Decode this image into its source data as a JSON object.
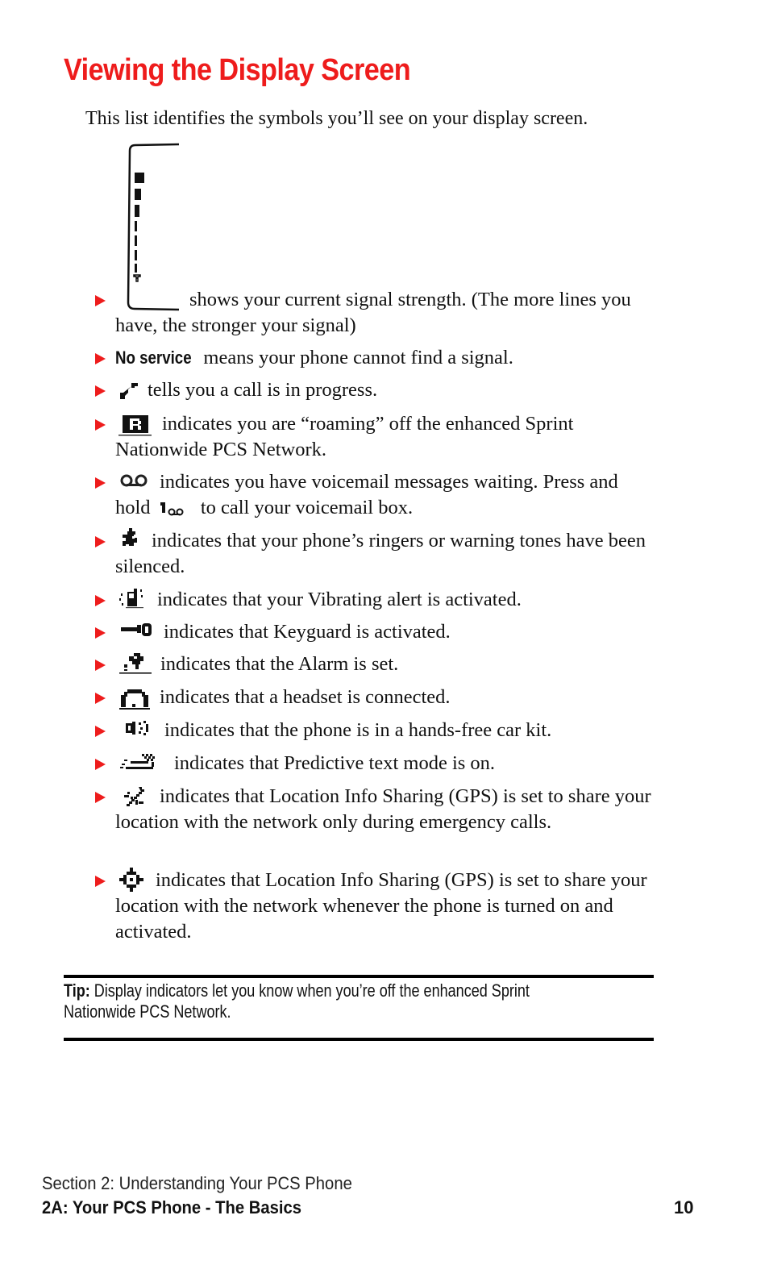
{
  "page": {
    "title": "Viewing the Display Screen",
    "intro": "This list identifies the symbols you’ll see on your display screen.",
    "accent_color": "#ee1c1c"
  },
  "items": [
    {
      "icon": "signal-strength-icon",
      "bold": "",
      "text": "shows your current signal strength. (The more lines you have, the stronger your signal)"
    },
    {
      "icon": "",
      "bold": "No service",
      "text": "means your phone cannot find a signal."
    },
    {
      "icon": "call-in-progress-icon",
      "bold": "",
      "text": "tells you a call is in progress."
    },
    {
      "icon": "roaming-icon",
      "bold": "",
      "text": "indicates you are “roaming” off the enhanced Sprint Nationwide PCS Network."
    },
    {
      "icon": "voicemail-icon",
      "bold": "",
      "text_a": "indicates you have voicemail messages waiting. Press and hold",
      "key_icon": "key-1-voicemail-icon",
      "text_b": "to call your voicemail box."
    },
    {
      "icon": "ringer-silenced-icon",
      "bold": "",
      "text": "indicates that your phone’s ringers or warning tones have been silenced."
    },
    {
      "icon": "vibrate-icon",
      "bold": "",
      "text": "indicates that your Vibrating alert is activated."
    },
    {
      "icon": "keyguard-icon",
      "bold": "",
      "text": "indicates that Keyguard is activated."
    },
    {
      "icon": "alarm-icon",
      "bold": "",
      "text": "indicates that the Alarm is set."
    },
    {
      "icon": "headset-icon",
      "bold": "",
      "text": "indicates that a headset is connected."
    },
    {
      "icon": "car-kit-icon",
      "bold": "",
      "text": "indicates that the phone is in a hands-free car kit."
    },
    {
      "icon": "predictive-text-icon",
      "bold": "",
      "text": "indicates that Predictive text mode is on."
    },
    {
      "icon": "gps-emergency-icon",
      "bold": "",
      "text": "indicates that Location Info Sharing (GPS) is set to share your location with the network only during emergency calls."
    },
    {
      "icon": "gps-on-icon",
      "bold": "",
      "text": "indicates that Location Info Sharing (GPS) is set to share your location with the network whenever the phone is turned on and activated."
    }
  ],
  "tip": {
    "label": "Tip:",
    "text": " Display indicators let you know when you’re off the enhanced Sprint Nationwide PCS Network."
  },
  "footer": {
    "section": "Section 2: Understanding Your PCS Phone",
    "chapter": "2A: Your PCS Phone - The Basics",
    "page_number": "10"
  }
}
